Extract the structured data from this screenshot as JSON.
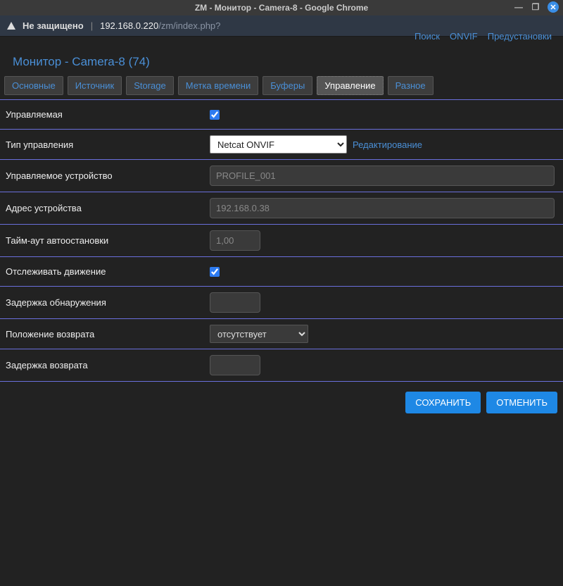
{
  "window": {
    "title": "ZM - Монитор - Camera-8 - Google Chrome"
  },
  "addressbar": {
    "insecure": "Не защищено",
    "host": "192.168.0.220",
    "path": "/zm/index.php?"
  },
  "header": {
    "title": "Монитор - Camera-8 (74)",
    "links": {
      "search": "Поиск",
      "onvif": "ONVIF",
      "presets": "Предустановки"
    }
  },
  "tabs": {
    "main": "Основные",
    "source": "Источник",
    "storage": "Storage",
    "timestamp": "Метка времени",
    "buffers": "Буферы",
    "control": "Управление",
    "misc": "Разное"
  },
  "form": {
    "controllable": {
      "label": "Управляемая"
    },
    "control_type": {
      "label": "Тип управления",
      "value": "Netcat ONVIF",
      "edit": "Редактирование"
    },
    "control_device": {
      "label": "Управляемое устройство",
      "placeholder": "PROFILE_001"
    },
    "device_address": {
      "label": "Адрес устройства",
      "placeholder": "192.168.0.38"
    },
    "autostop": {
      "label": "Тайм-аут автоостановки",
      "placeholder": "1,00"
    },
    "track_motion": {
      "label": "Отслеживать движение"
    },
    "detect_delay": {
      "label": "Задержка обнаружения"
    },
    "return_location": {
      "label": "Положение возврата",
      "value": "отсутствует"
    },
    "return_delay": {
      "label": "Задержка возврата"
    }
  },
  "buttons": {
    "save": "СОХРАНИТЬ",
    "cancel": "ОТМЕНИТЬ"
  }
}
